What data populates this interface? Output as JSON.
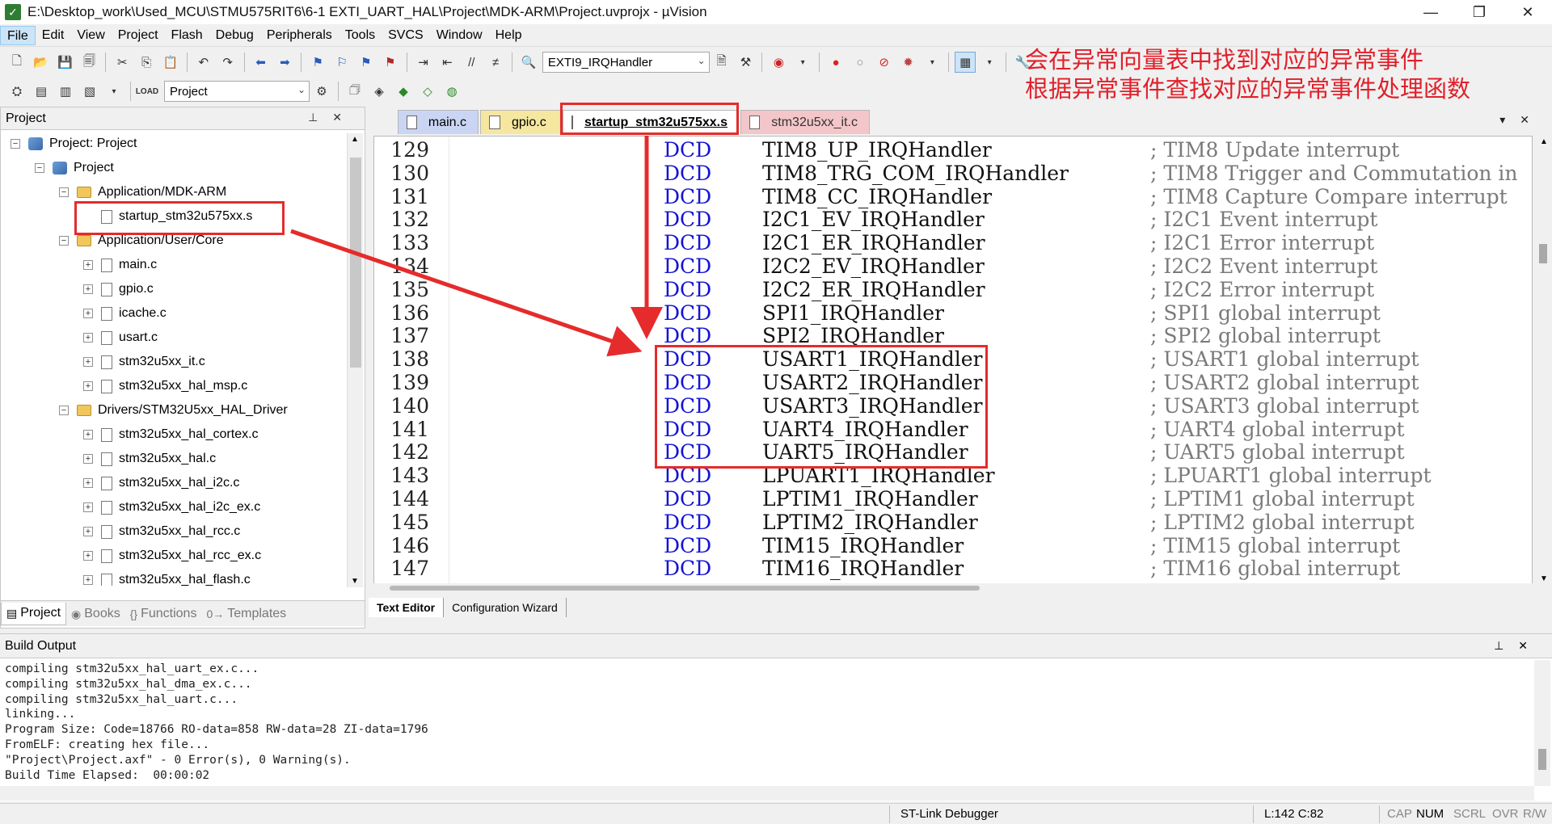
{
  "window": {
    "title": "E:\\Desktop_work\\Used_MCU\\STMU575RIT6\\6-1 EXTI_UART_HAL\\Project\\MDK-ARM\\Project.uvprojx - µVision",
    "minimize": "—",
    "maximize": "❐",
    "close": "✕"
  },
  "menu": [
    "File",
    "Edit",
    "View",
    "Project",
    "Flash",
    "Debug",
    "Peripherals",
    "Tools",
    "SVCS",
    "Window",
    "Help"
  ],
  "toolbar": {
    "function_combo": "EXTI9_IRQHandler",
    "target_combo": "Project"
  },
  "annotation": {
    "line1": "会在异常向量表中找到对应的异常事件",
    "line2": "根据异常事件查找对应的异常事件处理函数"
  },
  "project_panel": {
    "title": "Project",
    "pin": "📌",
    "close": "✕",
    "tree": [
      {
        "label": "Project: Project",
        "level": 0,
        "kind": "root",
        "exp": "−"
      },
      {
        "label": "Project",
        "level": 1,
        "kind": "proj",
        "exp": "−"
      },
      {
        "label": "Application/MDK-ARM",
        "level": 2,
        "kind": "folder",
        "exp": "−"
      },
      {
        "label": "startup_stm32u575xx.s",
        "level": 3,
        "kind": "file",
        "exp": ""
      },
      {
        "label": "Application/User/Core",
        "level": 2,
        "kind": "folder",
        "exp": "−"
      },
      {
        "label": "main.c",
        "level": 3,
        "kind": "file",
        "exp": "+"
      },
      {
        "label": "gpio.c",
        "level": 3,
        "kind": "file",
        "exp": "+"
      },
      {
        "label": "icache.c",
        "level": 3,
        "kind": "file",
        "exp": "+"
      },
      {
        "label": "usart.c",
        "level": 3,
        "kind": "file",
        "exp": "+"
      },
      {
        "label": "stm32u5xx_it.c",
        "level": 3,
        "kind": "file",
        "exp": "+"
      },
      {
        "label": "stm32u5xx_hal_msp.c",
        "level": 3,
        "kind": "file",
        "exp": "+"
      },
      {
        "label": "Drivers/STM32U5xx_HAL_Driver",
        "level": 2,
        "kind": "folder",
        "exp": "−"
      },
      {
        "label": "stm32u5xx_hal_cortex.c",
        "level": 3,
        "kind": "file",
        "exp": "+"
      },
      {
        "label": "stm32u5xx_hal.c",
        "level": 3,
        "kind": "file",
        "exp": "+"
      },
      {
        "label": "stm32u5xx_hal_i2c.c",
        "level": 3,
        "kind": "file",
        "exp": "+"
      },
      {
        "label": "stm32u5xx_hal_i2c_ex.c",
        "level": 3,
        "kind": "file",
        "exp": "+"
      },
      {
        "label": "stm32u5xx_hal_rcc.c",
        "level": 3,
        "kind": "file",
        "exp": "+"
      },
      {
        "label": "stm32u5xx_hal_rcc_ex.c",
        "level": 3,
        "kind": "file",
        "exp": "+"
      },
      {
        "label": "stm32u5xx_hal_flash.c",
        "level": 3,
        "kind": "file",
        "exp": "+"
      }
    ],
    "bottom_tabs": [
      {
        "icon": "▤",
        "label": "Project"
      },
      {
        "icon": "◉",
        "label": "Books"
      },
      {
        "icon": "{}",
        "label": "Functions"
      },
      {
        "icon": "0→",
        "label": "Templates"
      }
    ]
  },
  "editor": {
    "tabs": [
      "main.c",
      "gpio.c",
      "startup_stm32u575xx.s",
      "stm32u5xx_it.c"
    ],
    "lines": [
      {
        "num": "129",
        "op": "DCD",
        "handler": "TIM8_UP_IRQHandler",
        "comment": "; TIM8 Update interrupt"
      },
      {
        "num": "130",
        "op": "DCD",
        "handler": "TIM8_TRG_COM_IRQHandler",
        "comment": "; TIM8 Trigger and Commutation in"
      },
      {
        "num": "131",
        "op": "DCD",
        "handler": "TIM8_CC_IRQHandler",
        "comment": "; TIM8 Capture Compare interrupt"
      },
      {
        "num": "132",
        "op": "DCD",
        "handler": "I2C1_EV_IRQHandler",
        "comment": "; I2C1 Event interrupt"
      },
      {
        "num": "133",
        "op": "DCD",
        "handler": "I2C1_ER_IRQHandler",
        "comment": "; I2C1 Error interrupt"
      },
      {
        "num": "134",
        "op": "DCD",
        "handler": "I2C2_EV_IRQHandler",
        "comment": "; I2C2 Event interrupt"
      },
      {
        "num": "135",
        "op": "DCD",
        "handler": "I2C2_ER_IRQHandler",
        "comment": "; I2C2 Error interrupt"
      },
      {
        "num": "136",
        "op": "DCD",
        "handler": "SPI1_IRQHandler",
        "comment": "; SPI1 global interrupt"
      },
      {
        "num": "137",
        "op": "DCD",
        "handler": "SPI2_IRQHandler",
        "comment": "; SPI2 global interrupt"
      },
      {
        "num": "138",
        "op": "DCD",
        "handler": "USART1_IRQHandler",
        "comment": "; USART1 global interrupt"
      },
      {
        "num": "139",
        "op": "DCD",
        "handler": "USART2_IRQHandler",
        "comment": "; USART2 global interrupt"
      },
      {
        "num": "140",
        "op": "DCD",
        "handler": "USART3_IRQHandler",
        "comment": "; USART3 global interrupt"
      },
      {
        "num": "141",
        "op": "DCD",
        "handler": "UART4_IRQHandler",
        "comment": "; UART4 global interrupt"
      },
      {
        "num": "142",
        "op": "DCD",
        "handler": "UART5_IRQHandler",
        "comment": "; UART5 global interrupt"
      },
      {
        "num": "143",
        "op": "DCD",
        "handler": "LPUART1_IRQHandler",
        "comment": "; LPUART1 global interrupt"
      },
      {
        "num": "144",
        "op": "DCD",
        "handler": "LPTIM1_IRQHandler",
        "comment": "; LPTIM1 global interrupt"
      },
      {
        "num": "145",
        "op": "DCD",
        "handler": "LPTIM2_IRQHandler",
        "comment": "; LPTIM2 global interrupt"
      },
      {
        "num": "146",
        "op": "DCD",
        "handler": "TIM15_IRQHandler",
        "comment": "; TIM15 global interrupt"
      },
      {
        "num": "147",
        "op": "DCD",
        "handler": "TIM16_IRQHandler",
        "comment": "; TIM16 global interrupt"
      }
    ],
    "bottom_tabs": [
      "Text Editor",
      "Configuration Wizard"
    ]
  },
  "build_output": {
    "title": "Build Output",
    "lines": [
      "compiling stm32u5xx_hal_uart_ex.c...",
      "compiling stm32u5xx_hal_dma_ex.c...",
      "compiling stm32u5xx_hal_uart.c...",
      "linking...",
      "Program Size: Code=18766 RO-data=858 RW-data=28 ZI-data=1796",
      "FromELF: creating hex file...",
      "\"Project\\Project.axf\" - 0 Error(s), 0 Warning(s).",
      "Build Time Elapsed:  00:00:02"
    ]
  },
  "status": {
    "debugger": "ST-Link Debugger",
    "position": "L:142 C:82",
    "cap": "CAP",
    "num": "NUM",
    "scrl": "SCRL",
    "ovr": "OVR",
    "rw": "R/W"
  },
  "colors": {
    "highlight": "#e52b2b",
    "dcd_blue": "#1414d4",
    "comment_gray": "#7a7a7a",
    "annotation_red": "#e0202a"
  }
}
